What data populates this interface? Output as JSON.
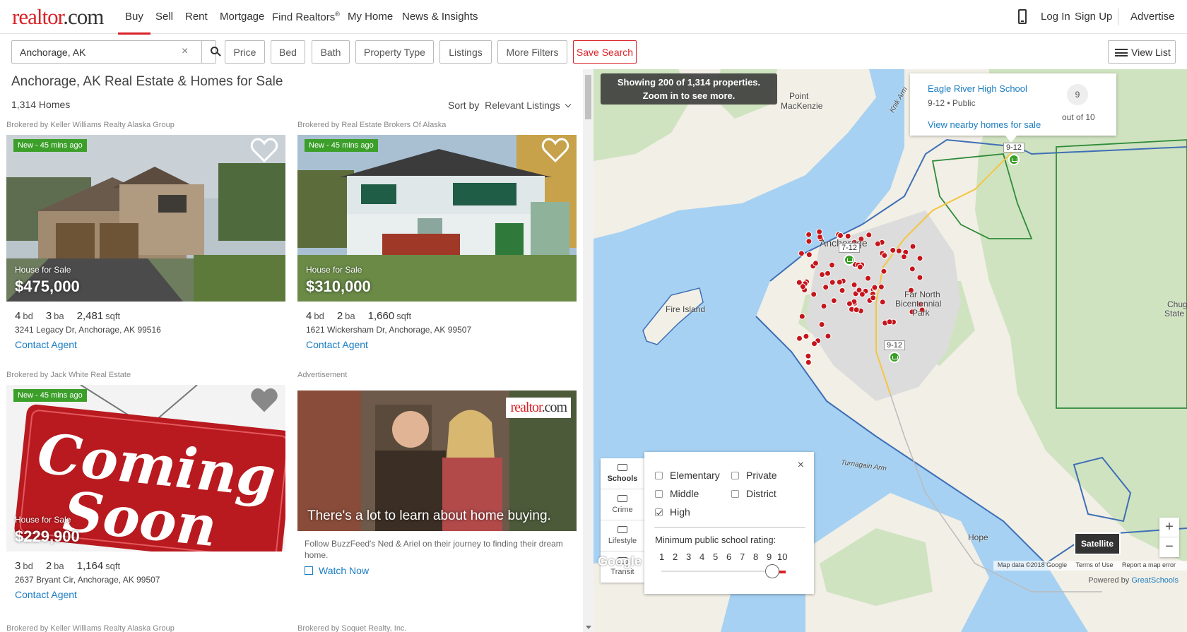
{
  "nav": {
    "logo_main": "realtor",
    "logo_dot": ".com",
    "items": [
      "Buy",
      "Sell",
      "Rent",
      "Mortgage",
      "Find Realtors",
      "My Home",
      "News & Insights"
    ],
    "find_realtors_mark": "®",
    "login": "Log In",
    "signup": "Sign Up",
    "advertise": "Advertise"
  },
  "filters": {
    "search_value": "Anchorage, AK",
    "clear": "×",
    "price": "Price",
    "bed": "Bed",
    "bath": "Bath",
    "property_type": "Property Type",
    "listings": "Listings",
    "more_filters": "More Filters",
    "save_search": "Save Search",
    "view_list": "View List"
  },
  "results": {
    "title": "Anchorage, AK Real Estate & Homes for Sale",
    "count": "1,314 Homes",
    "sort_label": "Sort by",
    "sort_value": "Relevant Listings"
  },
  "cards": [
    {
      "broker": "Brokered by Keller Williams Realty Alaska Group",
      "badge": "New - 45 mins ago",
      "type": "House for Sale",
      "price": "$475,000",
      "bd": "4",
      "ba": "3",
      "sqft": "2,481",
      "address": "3241 Legacy Dr, Anchorage, AK 99516",
      "contact": "Contact Agent"
    },
    {
      "broker": "Brokered by Real Estate Brokers Of Alaska",
      "badge": "New - 45 mins ago",
      "type": "House for Sale",
      "price": "$310,000",
      "bd": "4",
      "ba": "2",
      "sqft": "1,660",
      "address": "1621 Wickersham Dr, Anchorage, AK 99507",
      "contact": "Contact Agent"
    },
    {
      "broker": "Brokered by Jack White Real Estate",
      "badge": "New - 45 mins ago",
      "type": "House for Sale",
      "price": "$229,900",
      "bd": "3",
      "ba": "2",
      "sqft": "1,164",
      "address": "2637 Bryant Cir, Anchorage, AK 99507",
      "contact": "Contact Agent",
      "image_text_1": "Coming",
      "image_text_2": "Soon"
    }
  ],
  "units": {
    "bd": "bd",
    "ba": "ba",
    "sqft": "sqft"
  },
  "next_brokers": [
    "Brokered by Keller Williams Realty Alaska Group",
    "Brokered by Soquet Realty, Inc."
  ],
  "ad": {
    "label": "Advertisement",
    "logo_main": "realtor",
    "logo_dot": ".com",
    "headline": "There's a lot to learn about home buying.",
    "text": "Follow BuzzFeed's Ned & Ariel on their journey to finding their dream home.",
    "link": "Watch Now"
  },
  "map": {
    "notice_1": "Showing 200 of 1,314 properties.",
    "notice_2": "Zoom in to see more.",
    "labels": {
      "point_mackenzie_1": "Point",
      "point_mackenzie_2": "MacKenzie",
      "knik_arm": "Knik Arm",
      "anchorage": "Anchorage",
      "fire_island": "Fire Island",
      "far_north_1": "Far North",
      "far_north_2": "Bicentennial",
      "far_north_3": "Park",
      "turnagain_arm": "Turnagain Arm",
      "hope": "Hope",
      "chugach_1": "Chug",
      "chugach_2": "State"
    },
    "school_pins": [
      "9-12",
      "7-12",
      "9-12"
    ],
    "popup": {
      "name": "Eagle River High School",
      "grades": "9-12 • Public",
      "rating": "9",
      "out_of": "out of 10",
      "link": "View nearby homes for sale"
    },
    "layers": [
      "Schools",
      "Crime",
      "Lifestyle",
      "Transit"
    ],
    "schools_panel": {
      "close": "×",
      "elementary": "Elementary",
      "private": "Private",
      "middle": "Middle",
      "district": "District",
      "high": "High",
      "high_checked": true,
      "min_rating_label": "Minimum public school rating:",
      "ratings": [
        "1",
        "2",
        "3",
        "4",
        "5",
        "6",
        "7",
        "8",
        "9",
        "10"
      ],
      "selected_rating": 10
    },
    "satellite": "Satellite",
    "zoom_in": "+",
    "zoom_out": "−",
    "google": "Google",
    "footer": [
      "Map data ©2018 Google",
      "Terms of Use",
      "Report a map error"
    ],
    "powered_by": "Powered by",
    "powered_brand": "GreatSchools"
  }
}
